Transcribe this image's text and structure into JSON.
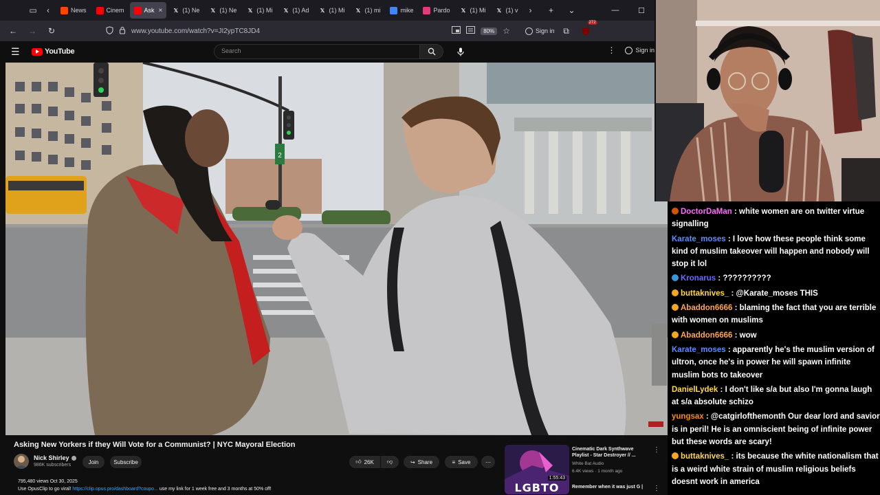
{
  "browser": {
    "tabs": [
      {
        "label": "News",
        "favicon": "reddit-icon",
        "color": "#ff4500"
      },
      {
        "label": "Cinem",
        "favicon": "youtube-icon",
        "color": "#ff0000"
      },
      {
        "label": "Ask",
        "favicon": "youtube-icon",
        "color": "#ff0000",
        "active": true,
        "close": "×"
      },
      {
        "label": "(1) Ne",
        "favicon": "x-icon",
        "color": "#000000"
      },
      {
        "label": "(1) Ne",
        "favicon": "x-icon",
        "color": "#000000"
      },
      {
        "label": "(1) Mi",
        "favicon": "x-icon",
        "color": "#000000"
      },
      {
        "label": "(1) Ad",
        "favicon": "x-icon",
        "color": "#000000"
      },
      {
        "label": "(1) Mi",
        "favicon": "x-icon",
        "color": "#000000"
      },
      {
        "label": "(1) mi",
        "favicon": "x-icon",
        "color": "#000000"
      },
      {
        "label": "mike",
        "favicon": "google-icon",
        "color": "#4285f4"
      },
      {
        "label": "Pardo",
        "favicon": "dots-icon",
        "color": "#e23b7e"
      },
      {
        "label": "(1) Mi",
        "favicon": "x-icon",
        "color": "#000000"
      },
      {
        "label": "(1) v",
        "favicon": "x-icon",
        "color": "#000000"
      }
    ],
    "url": "www.youtube.com/watch?v=JI2ypTC8JD4",
    "zoom": "80%",
    "sign_in": "Sign in",
    "notification_count": "272"
  },
  "youtube": {
    "logo_text": "YouTube",
    "search_placeholder": "Search",
    "sign_in": "Sign in",
    "video": {
      "title": "Asking New Yorkers if they Will Vote for a Communist? | NYC Mayoral Election",
      "channel": "Nick Shirley",
      "subscribers": "986K subscribers",
      "join": "Join",
      "subscribe": "Subscribe",
      "likes": "26K",
      "share": "Share",
      "save": "Save",
      "views_date": "795,480 views  Oct 30, 2025",
      "desc_prefix": "Use OpusClip to go viral! ",
      "desc_link": "https://clip.opus.pro/dashboard?coupo...",
      "desc_suffix": " use my link for 1 week free and 3 months at 50% off!",
      "street_sign": "2"
    },
    "recommended": {
      "title": "Cinematic Dark Synthwave Playlist - Star Destroyer // ...",
      "channel": "White Bat Audio",
      "meta": "6.4K views · 1 month ago",
      "duration": "1:55:43",
      "thumb_text": "LGBTO",
      "next_title": "Remember when it was just G |"
    }
  },
  "chat": {
    "messages": [
      {
        "user": "DoctorDaMan",
        "color": "#ff69ff",
        "badge": "#d35400",
        "text": "white women are on twitter virtue signalling"
      },
      {
        "user": "Karate_moses",
        "color": "#5a8dff",
        "badge": "",
        "text": "I love how these people think some kind of muslim takeover will happen and nobody will stop it lol"
      },
      {
        "user": "Kronarus",
        "color": "#6a6aff",
        "badge": "#3498db",
        "text": "??????????"
      },
      {
        "user": "buttaknives_",
        "color": "#ffd84a",
        "badge": "#f5a623",
        "text": "@Karate_moses THIS"
      },
      {
        "user": "Abaddon6666",
        "color": "#ffa64d",
        "badge": "#f5a623",
        "text": "blaming the fact that you are terrible with women on muslims"
      },
      {
        "user": "Abaddon6666",
        "color": "#ffa64d",
        "badge": "#f5a623",
        "text": "wow"
      },
      {
        "user": "Karate_moses",
        "color": "#5a8dff",
        "badge": "",
        "text": "apparently he's the muslim version of ultron, once he's in power he will spawn infinite muslim bots to takeover"
      },
      {
        "user": "DanielLydek",
        "color": "#ffd84a",
        "badge": "",
        "text": "I don't like s/a but also I'm gonna laugh at s/a absolute schizo"
      },
      {
        "user": "yungsax",
        "color": "#ff8c00",
        "badge": "",
        "text": "@catgirlofthemonth Our dear lord and savior is in peril! He is an omniscient being of infinite power but these words are scary!"
      },
      {
        "user": "buttaknives_",
        "color": "#ffd84a",
        "badge": "#f5a623",
        "text": "its because the white nationalism that is a weird white strain of muslim religious beliefs doesnt work in america"
      }
    ]
  }
}
